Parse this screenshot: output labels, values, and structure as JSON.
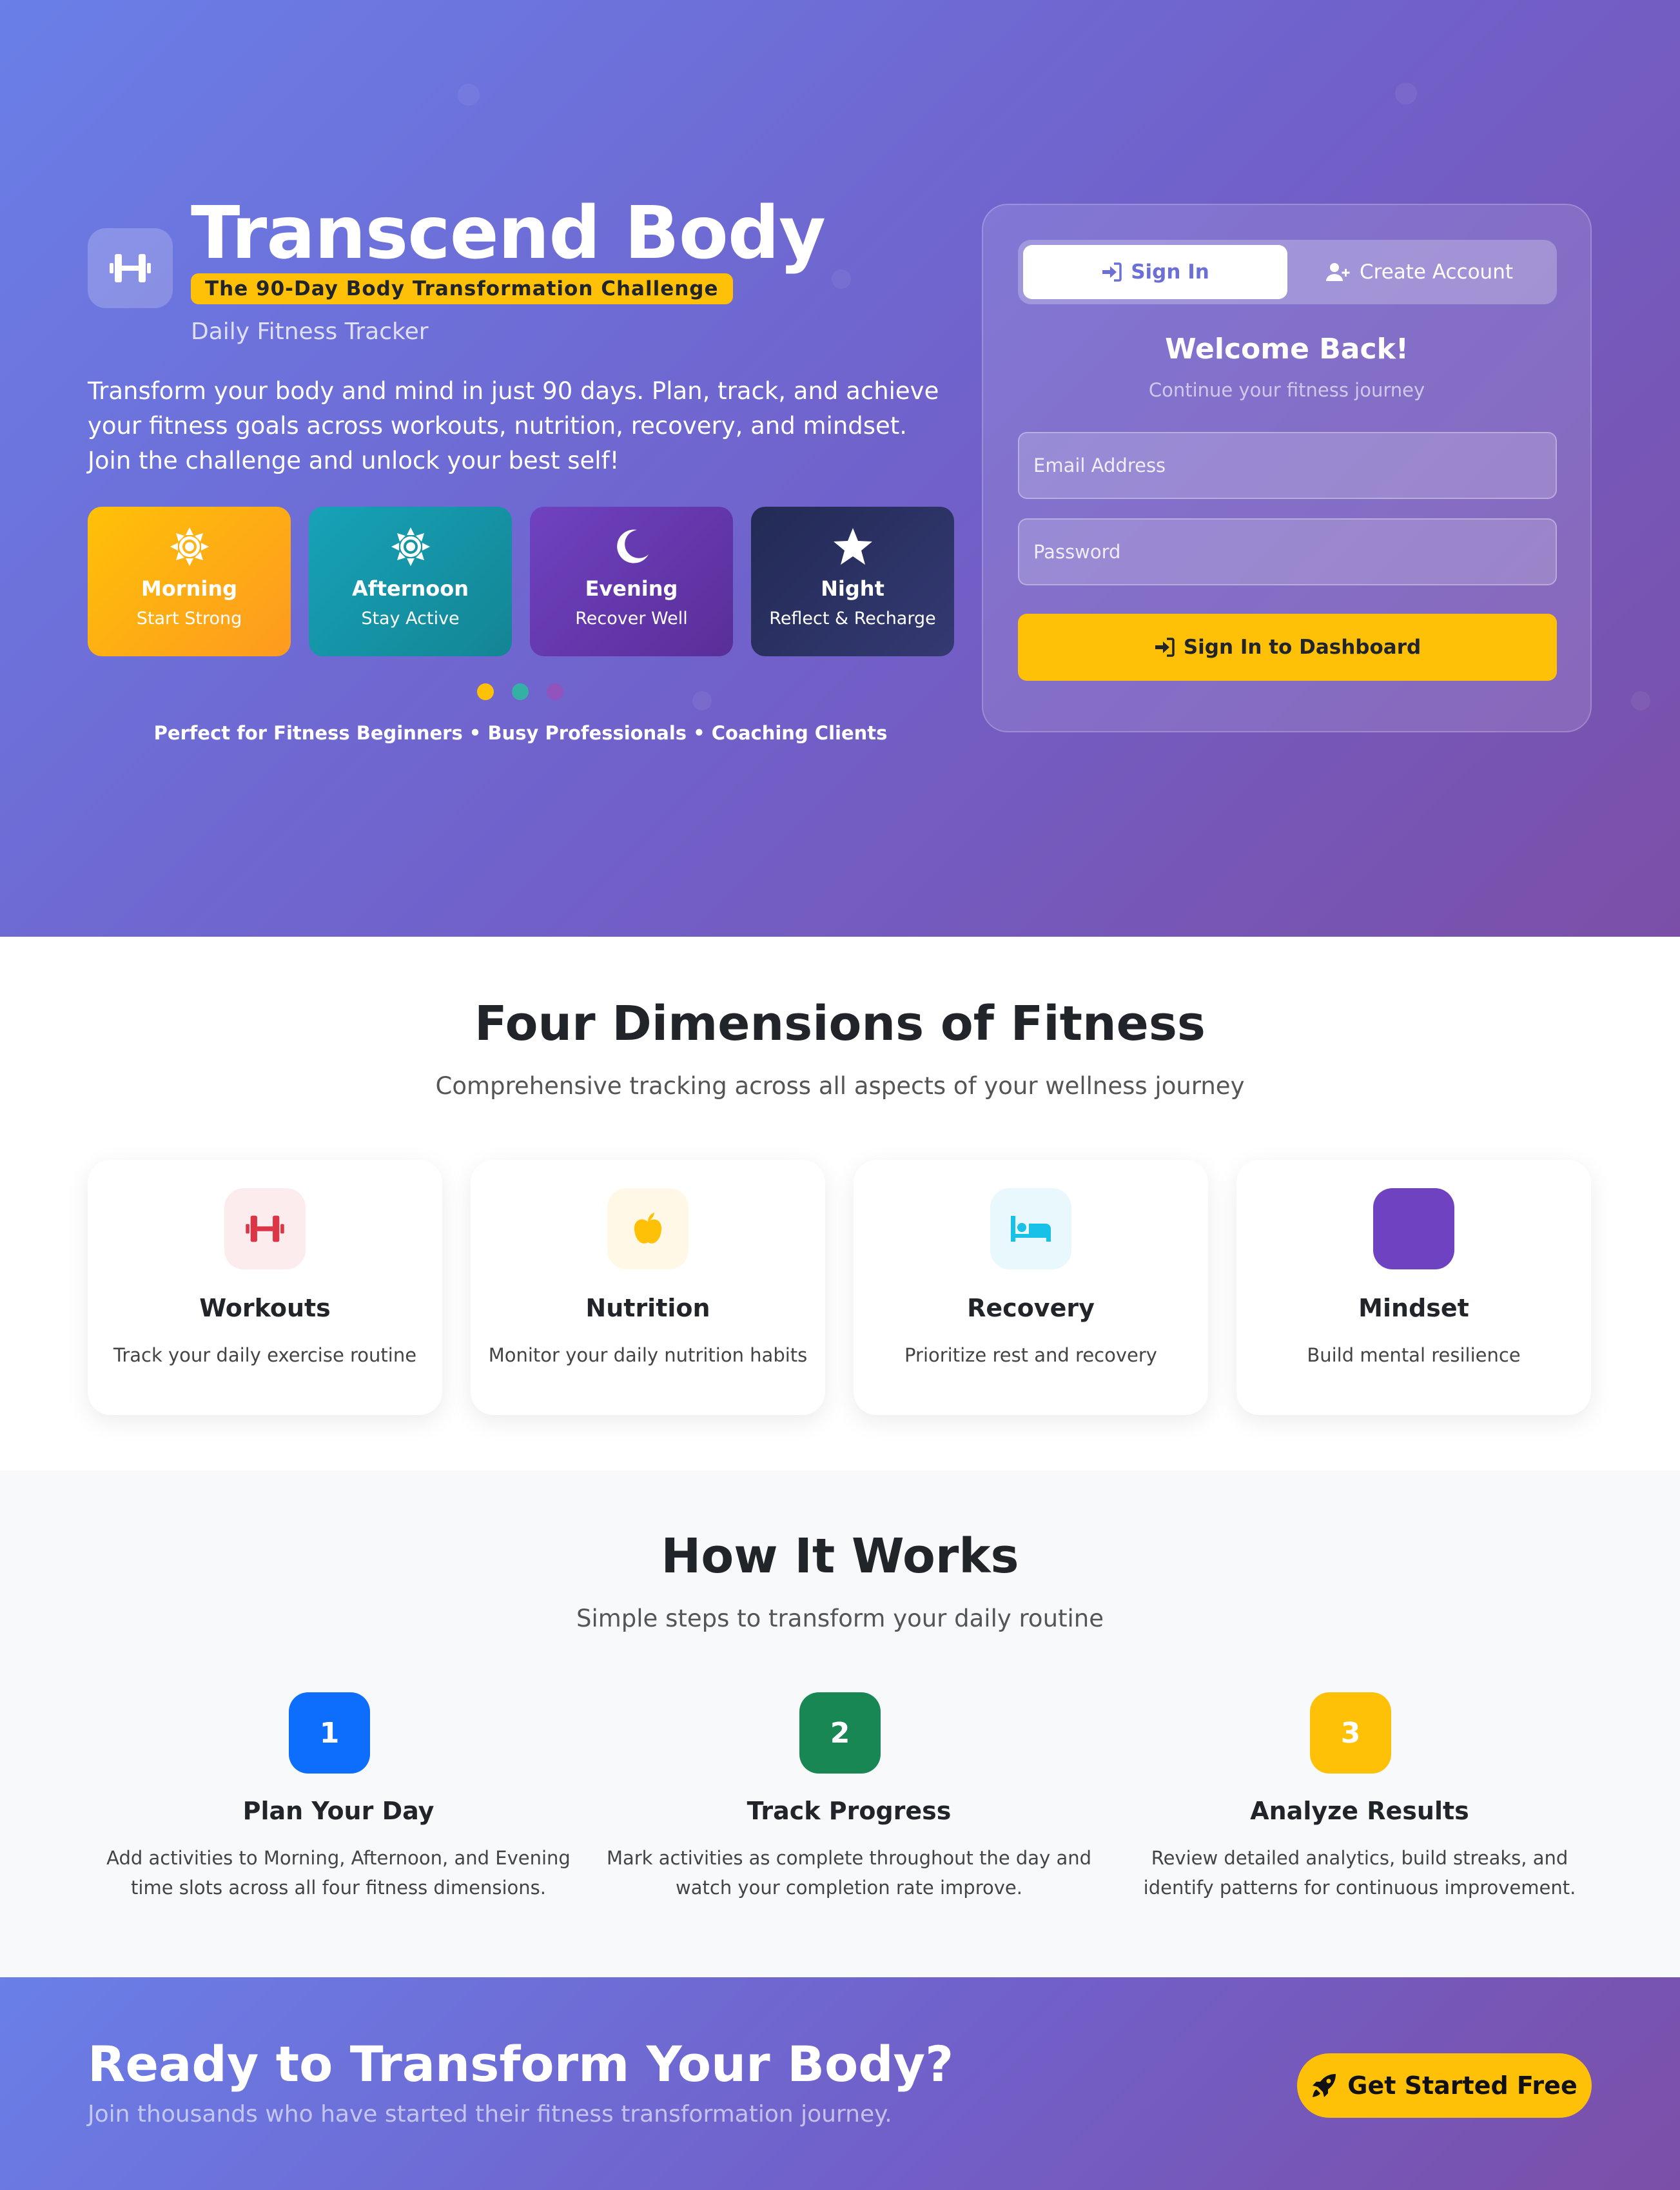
{
  "brand": {
    "title": "Transcend Body",
    "badge": "The 90-Day Body Transformation Challenge",
    "subtitle": "Daily Fitness Tracker"
  },
  "hero": {
    "description": "Transform your body and mind in just 90 days. Plan, track, and achieve your fitness goals across workouts, nutrition, recovery, and mindset. Join the challenge and unlock your best self!",
    "slots": [
      {
        "title": "Morning",
        "subtitle": "Start Strong",
        "icon": "sun-icon"
      },
      {
        "title": "Afternoon",
        "subtitle": "Stay Active",
        "icon": "sun-icon"
      },
      {
        "title": "Evening",
        "subtitle": "Recover Well",
        "icon": "moon-icon"
      },
      {
        "title": "Night",
        "subtitle": "Reflect & Recharge",
        "icon": "star-icon"
      }
    ],
    "carousel_dot_colors": [
      "#ffc107",
      "#20c997",
      "#9c4fb8"
    ],
    "audience": "Perfect for Fitness Beginners • Busy Professionals • Coaching Clients"
  },
  "auth": {
    "tabs": [
      {
        "label": "Sign In",
        "active": true,
        "icon": "sign-in-icon"
      },
      {
        "label": "Create Account",
        "active": false,
        "icon": "user-plus-icon"
      }
    ],
    "title": "Welcome Back!",
    "subtitle": "Continue your fitness journey",
    "email_placeholder": "Email Address",
    "password_placeholder": "Password",
    "submit_label": "Sign In to Dashboard"
  },
  "dimensions": {
    "title": "Four Dimensions of Fitness",
    "subtitle": "Comprehensive tracking across all aspects of your wellness journey",
    "cards": [
      {
        "title": "Workouts",
        "description": "Track your daily exercise routine",
        "icon": "dumbbell-icon",
        "color": "#dc3545"
      },
      {
        "title": "Nutrition",
        "description": "Monitor your daily nutrition habits",
        "icon": "apple-icon",
        "color": "#ffc107"
      },
      {
        "title": "Recovery",
        "description": "Prioritize rest and recovery",
        "icon": "bed-icon",
        "color": "#17c1e8"
      },
      {
        "title": "Mindset",
        "description": "Build mental resilience",
        "icon": "brain-icon",
        "color": "#6f42c1"
      }
    ]
  },
  "how": {
    "title": "How It Works",
    "subtitle": "Simple steps to transform your daily routine",
    "steps": [
      {
        "number": "1",
        "title": "Plan Your Day",
        "description": "Add activities to Morning, Afternoon, and Evening time slots across all four fitness dimensions.",
        "color": "#0d6efd"
      },
      {
        "number": "2",
        "title": "Track Progress",
        "description": "Mark activities as complete throughout the day and watch your completion rate improve.",
        "color": "#198754"
      },
      {
        "number": "3",
        "title": "Analyze Results",
        "description": "Review detailed analytics, build streaks, and identify patterns for continuous improvement.",
        "color": "#ffc107"
      }
    ]
  },
  "cta": {
    "title": "Ready to Transform Your Body?",
    "subtitle": "Join thousands who have started their fitness transformation journey.",
    "button_label": "Get Started Free",
    "button_icon": "rocket-icon"
  }
}
